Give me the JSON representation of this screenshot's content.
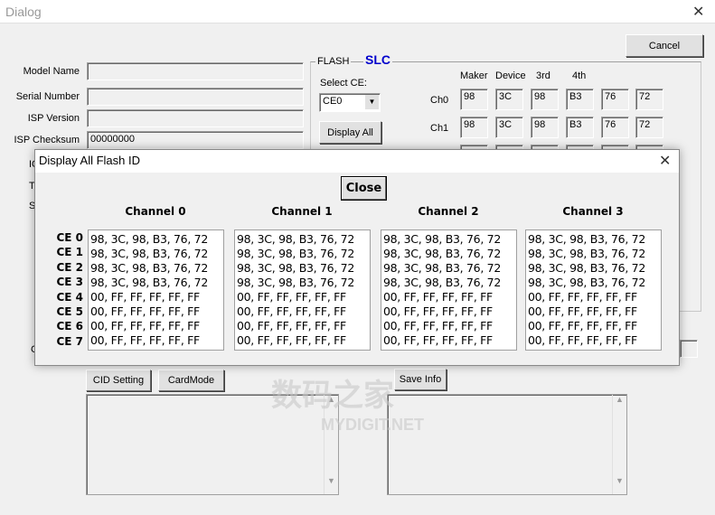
{
  "window": {
    "title": "Dialog",
    "close_icon": "close-icon"
  },
  "cancel_label": "Cancel",
  "left_fields": [
    {
      "label": "Model Name",
      "value": ""
    },
    {
      "label": "Serial Number",
      "value": ""
    },
    {
      "label": "ISP Version",
      "value": ""
    },
    {
      "label": "ISP Checksum",
      "value": "00000000"
    }
  ],
  "partial_labels": [
    "IC",
    "T",
    "S",
    "C"
  ],
  "flash": {
    "group_label": "FLASH",
    "type": "SLC",
    "type_color": "#0000cc",
    "select_label": "Select CE:",
    "select_value": "CE0",
    "display_all_label": "Display All",
    "col_headers": [
      "Maker",
      "Device",
      "3rd",
      "4th"
    ],
    "rows": [
      {
        "label": "Ch0",
        "values": [
          "98",
          "3C",
          "98",
          "B3",
          "76",
          "72"
        ]
      },
      {
        "label": "Ch1",
        "values": [
          "98",
          "3C",
          "98",
          "B3",
          "76",
          "72"
        ]
      }
    ]
  },
  "buttons": {
    "cid_setting": "CID Setting",
    "card_mode": "CardMode",
    "save_info": "Save Info"
  },
  "watermark": {
    "cn": "数码之家",
    "en": "MYDIGIT.NET"
  },
  "modal": {
    "title": "Display All Flash ID",
    "close_label": "Close",
    "ce_labels": [
      "CE 0",
      "CE 1",
      "CE 2",
      "CE 3",
      "CE 4",
      "CE 5",
      "CE 6",
      "CE 7"
    ],
    "channels": [
      {
        "name": "Channel 0",
        "ids": "98, 3C, 98, B3, 76, 72\n98, 3C, 98, B3, 76, 72\n98, 3C, 98, B3, 76, 72\n98, 3C, 98, B3, 76, 72\n00, FF, FF, FF, FF, FF\n00, FF, FF, FF, FF, FF\n00, FF, FF, FF, FF, FF\n00, FF, FF, FF, FF, FF"
      },
      {
        "name": "Channel 1",
        "ids": "98, 3C, 98, B3, 76, 72\n98, 3C, 98, B3, 76, 72\n98, 3C, 98, B3, 76, 72\n98, 3C, 98, B3, 76, 72\n00, FF, FF, FF, FF, FF\n00, FF, FF, FF, FF, FF\n00, FF, FF, FF, FF, FF\n00, FF, FF, FF, FF, FF"
      },
      {
        "name": "Channel 2",
        "ids": "98, 3C, 98, B3, 76, 72\n98, 3C, 98, B3, 76, 72\n98, 3C, 98, B3, 76, 72\n98, 3C, 98, B3, 76, 72\n00, FF, FF, FF, FF, FF\n00, FF, FF, FF, FF, FF\n00, FF, FF, FF, FF, FF\n00, FF, FF, FF, FF, FF"
      },
      {
        "name": "Channel 3",
        "ids": "98, 3C, 98, B3, 76, 72\n98, 3C, 98, B3, 76, 72\n98, 3C, 98, B3, 76, 72\n98, 3C, 98, B3, 76, 72\n00, FF, FF, FF, FF, FF\n00, FF, FF, FF, FF, FF\n00, FF, FF, FF, FF, FF\n00, FF, FF, FF, FF, FF"
      }
    ]
  }
}
